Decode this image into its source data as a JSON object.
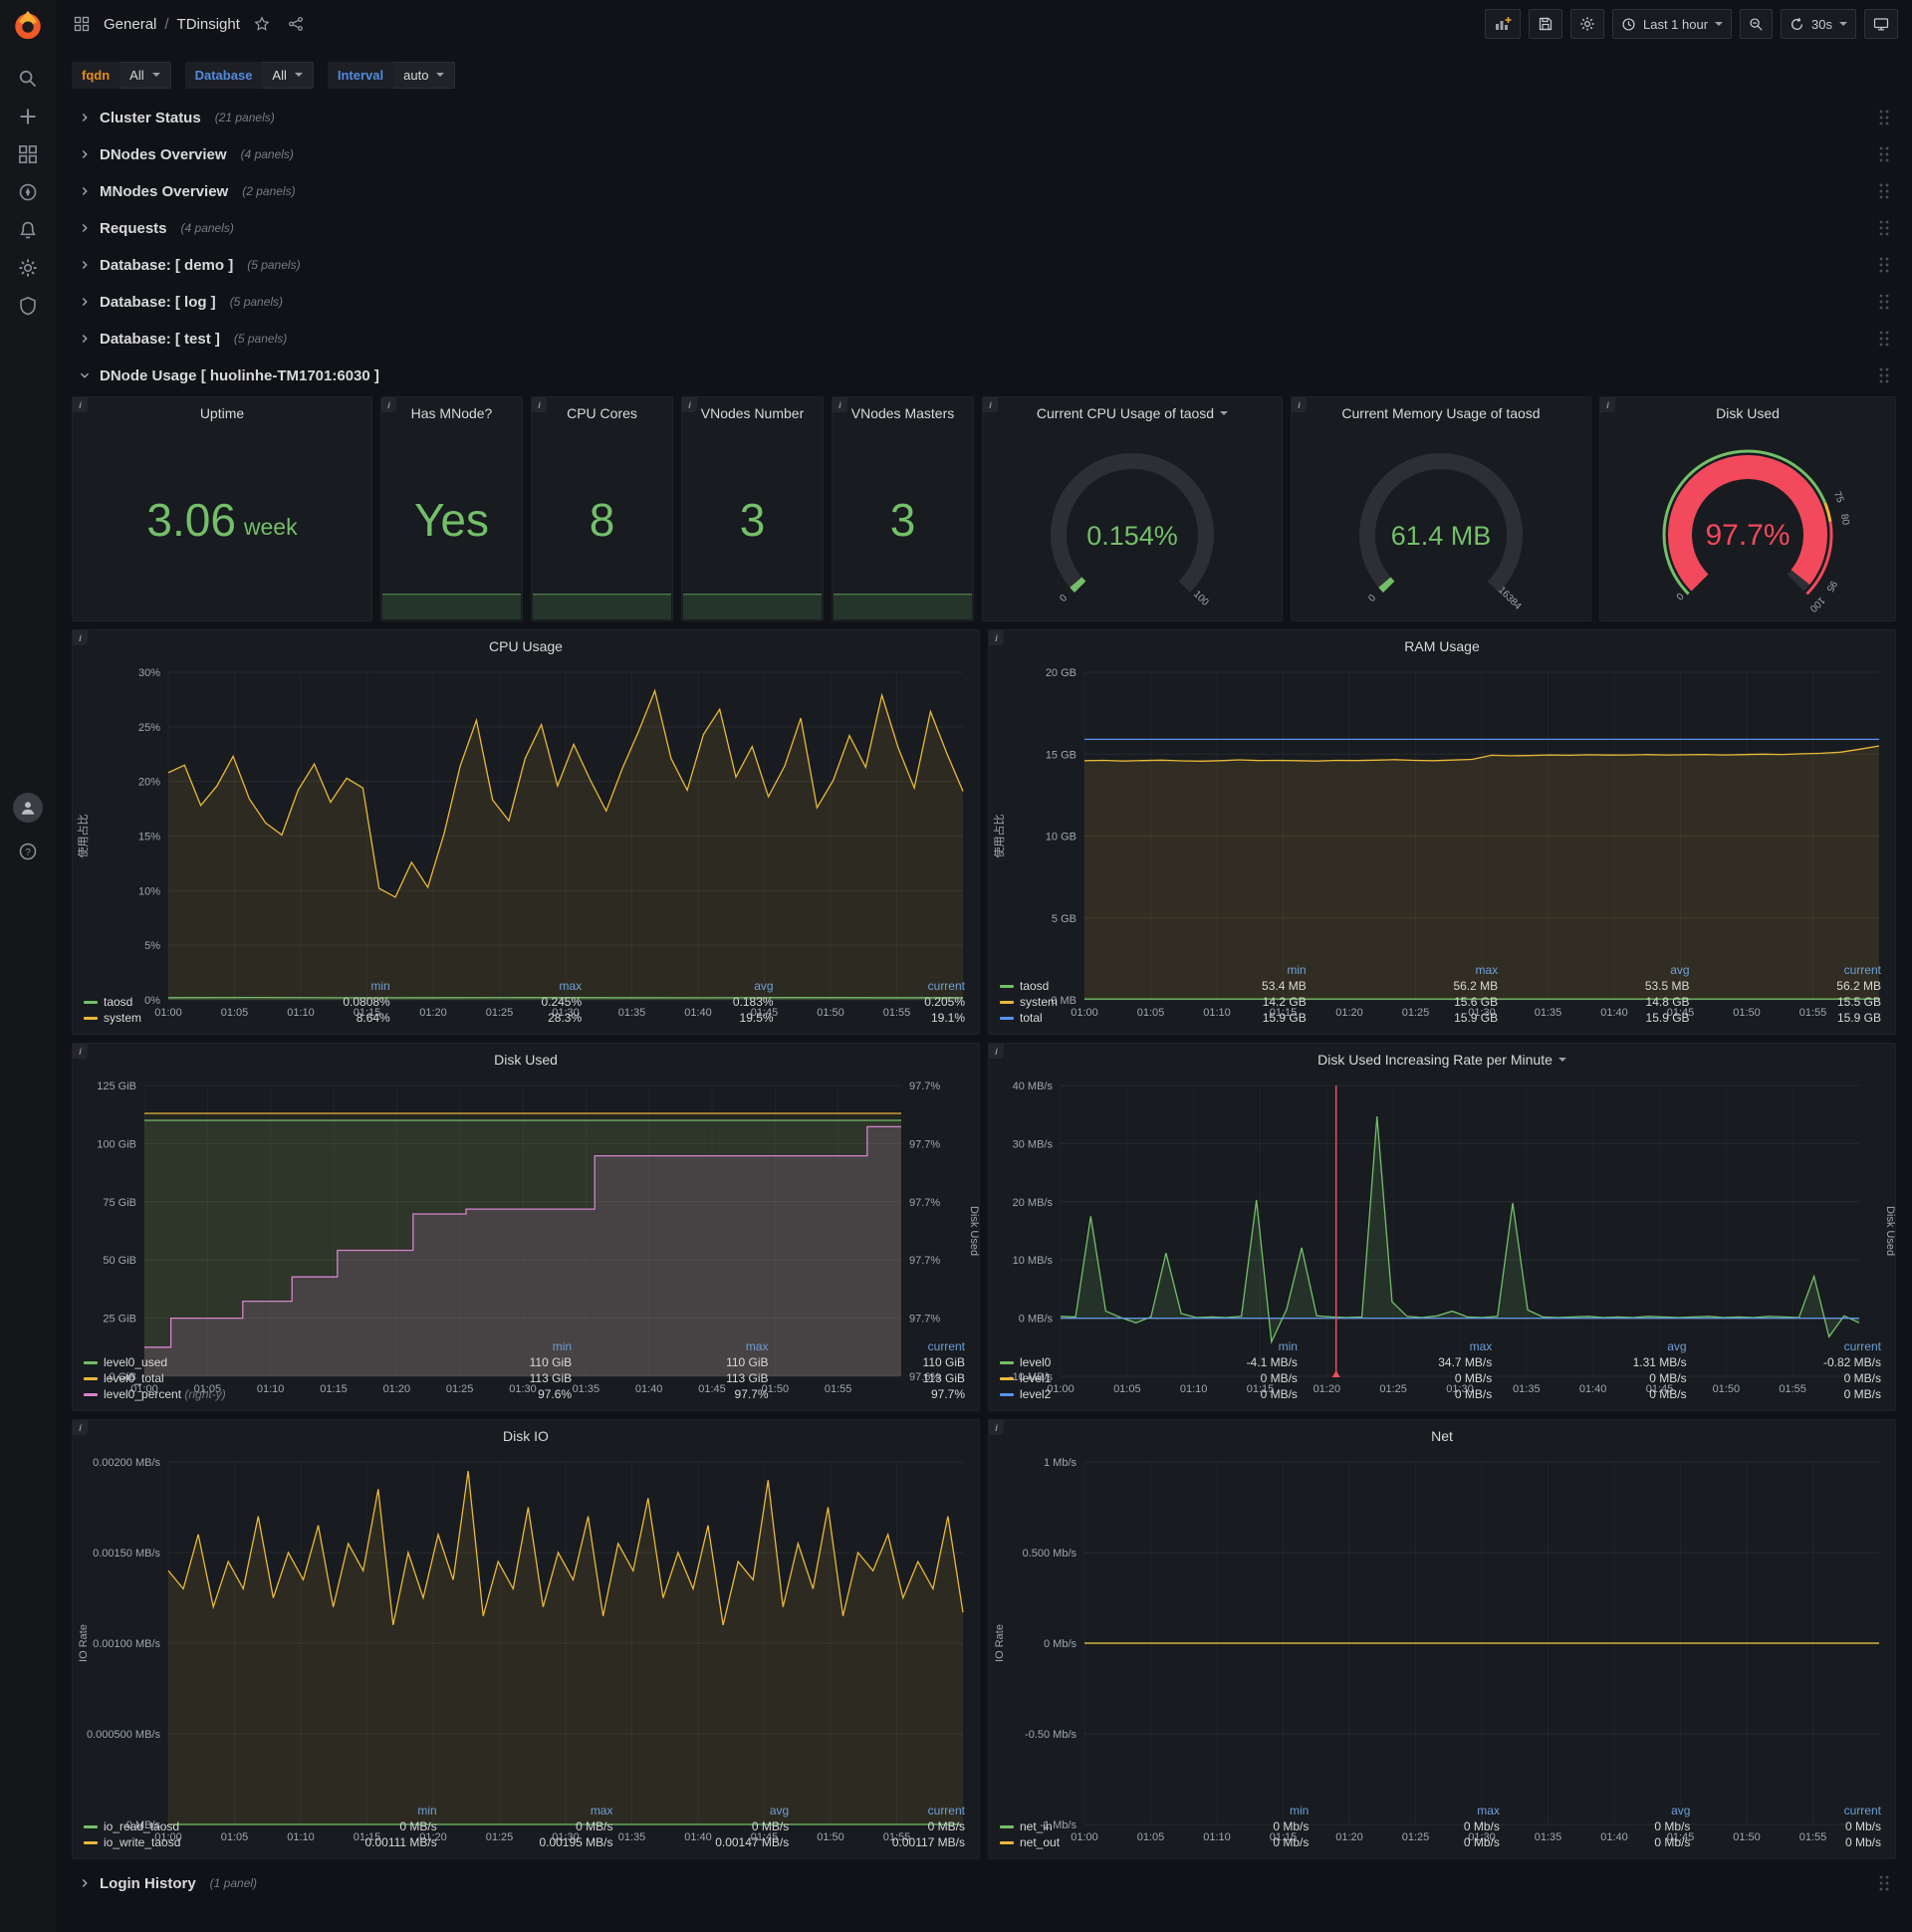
{
  "colors": {
    "green": "#73bf69",
    "yellow": "#eab839",
    "blue": "#5794f2",
    "pink": "#d683ce",
    "red": "#f2495c",
    "brand": "#f05a28",
    "legend_header": "#6e9fd8",
    "fqdn_label": "#e58c1d",
    "var_label": "#538ade"
  },
  "icons": {
    "rail": [
      "grafana-logo",
      "search",
      "plus",
      "dashboards",
      "explore",
      "alerting",
      "configuration",
      "server-admin",
      "avatar",
      "help"
    ],
    "navbar": [
      "dashboard-grid",
      "star",
      "share",
      "panel-add",
      "save",
      "settings",
      "clock",
      "zoom-out",
      "refresh",
      "caret-down",
      "tv"
    ]
  },
  "nav": {
    "breadcrumb": {
      "section": "General",
      "separator": "/",
      "title": "TDinsight"
    },
    "actions": {
      "time_range": "Last 1 hour",
      "refresh_interval": "30s"
    }
  },
  "filters": {
    "fqdn": {
      "label": "fqdn",
      "value": "All"
    },
    "database": {
      "label": "Database",
      "value": "All"
    },
    "interval": {
      "label": "Interval",
      "value": "auto"
    }
  },
  "collapsed_rows": [
    {
      "title": "Cluster Status",
      "count": "(21 panels)"
    },
    {
      "title": "DNodes Overview",
      "count": "(4 panels)"
    },
    {
      "title": "MNodes Overview",
      "count": "(2 panels)"
    },
    {
      "title": "Requests",
      "count": "(4 panels)"
    },
    {
      "title": "Database: [ demo ]",
      "count": "(5 panels)"
    },
    {
      "title": "Database: [ log ]",
      "count": "(5 panels)"
    },
    {
      "title": "Database: [ test ]",
      "count": "(5 panels)"
    }
  ],
  "expanded_row": {
    "title": "DNode Usage [ huolinhe-TM1701:6030 ]"
  },
  "bottom_row": {
    "title": "Login History",
    "count": "(1 panel)"
  },
  "stats": [
    {
      "title": "Uptime",
      "value": "3.06",
      "unit": "week"
    },
    {
      "title": "Has MNode?",
      "value": "Yes",
      "unit": ""
    },
    {
      "title": "CPU Cores",
      "value": "8",
      "unit": ""
    },
    {
      "title": "VNodes Number",
      "value": "3",
      "unit": ""
    },
    {
      "title": "VNodes Masters",
      "value": "3",
      "unit": ""
    }
  ],
  "gauges": [
    {
      "title": "Current CPU Usage of taosd",
      "has_caret": true,
      "value": "0.154%",
      "fraction": 0.00154,
      "color": "#73bf69",
      "min": "0",
      "max": "100",
      "thresholds": null
    },
    {
      "title": "Current Memory Usage of taosd",
      "has_caret": false,
      "value": "61.4 MB",
      "fraction": 0.0037,
      "color": "#73bf69",
      "min": "0",
      "max": "16384",
      "thresholds": null
    },
    {
      "title": "Disk Used",
      "has_caret": false,
      "value": "97.7%",
      "fraction": 0.977,
      "color": "#f2495c",
      "min": "0",
      "max": null,
      "thresholds": [
        {
          "frac": 0.75,
          "label": "75"
        },
        {
          "frac": 0.8,
          "label": "80"
        },
        {
          "frac": 0.95,
          "label": "95"
        },
        {
          "frac": 1,
          "label": "100"
        }
      ]
    }
  ],
  "chart_data": [
    {
      "type": "line",
      "title": "CPU Usage",
      "has_caret": false,
      "ylabel": "使用占比",
      "ylim": [
        0,
        30
      ],
      "y_ticks": [
        "30%",
        "25%",
        "20%",
        "15%",
        "10%",
        "5%",
        "0%"
      ],
      "x_ticks": [
        "01:00",
        "01:05",
        "01:10",
        "01:15",
        "01:20",
        "01:25",
        "01:30",
        "01:35",
        "01:40",
        "01:45",
        "01:50",
        "01:55"
      ],
      "legend": {
        "columns": [
          "min",
          "max",
          "avg",
          "current"
        ],
        "rows": [
          {
            "name": "taosd",
            "color": "#73bf69",
            "values": [
              "0.0808%",
              "0.245%",
              "0.183%",
              "0.205%"
            ]
          },
          {
            "name": "system",
            "color": "#eab839",
            "values": [
              "8.64%",
              "28.3%",
              "19.5%",
              "19.1%"
            ]
          }
        ]
      },
      "series": [
        {
          "name": "system",
          "color": "#eab839",
          "fill": 0.1,
          "values": [
            20.8,
            21.5,
            17.8,
            19.6,
            22.3,
            18.4,
            16.2,
            15.1,
            19.2,
            21.6,
            18.1,
            20.3,
            19.4,
            10.2,
            9.4,
            12.6,
            10.3,
            15.2,
            21.4,
            25.6,
            18.3,
            16.4,
            22.1,
            25.2,
            19.6,
            23.4,
            20.2,
            17.3,
            21.2,
            24.6,
            28.3,
            22.1,
            19.2,
            24.3,
            26.6,
            20.4,
            23.2,
            18.6,
            21.4,
            25.8,
            17.6,
            20.1,
            24.2,
            21.3,
            27.9,
            23.1,
            19.4,
            26.4,
            22.6,
            19.1
          ]
        },
        {
          "name": "taosd",
          "color": "#73bf69",
          "fill": 0.15,
          "values": [
            0.2,
            0.22,
            0.19,
            0.2,
            0.21,
            0.2,
            0.19,
            0.21,
            0.2,
            0.2
          ]
        }
      ]
    },
    {
      "type": "line",
      "title": "RAM Usage",
      "has_caret": false,
      "ylabel": "使用占比",
      "ylim": [
        0,
        20
      ],
      "y_ticks": [
        "20 GB",
        "15 GB",
        "10 GB",
        "5 GB",
        "0 MB"
      ],
      "x_ticks": [
        "01:00",
        "01:05",
        "01:10",
        "01:15",
        "01:20",
        "01:25",
        "01:30",
        "01:35",
        "01:40",
        "01:45",
        "01:50",
        "01:55"
      ],
      "legend": {
        "columns": [
          "min",
          "max",
          "avg",
          "current"
        ],
        "rows": [
          {
            "name": "taosd",
            "color": "#73bf69",
            "values": [
              "53.4 MB",
              "56.2 MB",
              "53.5 MB",
              "56.2 MB"
            ]
          },
          {
            "name": "system",
            "color": "#eab839",
            "values": [
              "14.2 GB",
              "15.6 GB",
              "14.8 GB",
              "15.5 GB"
            ]
          },
          {
            "name": "total",
            "color": "#5794f2",
            "values": [
              "15.9 GB",
              "15.9 GB",
              "15.9 GB",
              "15.9 GB"
            ]
          }
        ]
      },
      "series": [
        {
          "name": "system",
          "color": "#eab839",
          "fill": 0.12,
          "values": [
            14.6,
            14.62,
            14.58,
            14.61,
            14.63,
            14.59,
            14.57,
            14.6,
            14.65,
            14.61,
            14.62,
            14.6,
            14.58,
            14.62,
            14.61,
            14.63,
            14.66,
            14.62,
            14.6,
            14.64,
            14.68,
            14.93,
            14.9,
            14.92,
            14.95,
            14.93,
            14.96,
            14.94,
            14.95,
            14.97,
            14.95,
            14.96,
            14.98,
            14.95,
            14.97,
            15.0,
            14.98,
            15.02,
            15.05,
            15.12,
            15.3,
            15.5
          ]
        },
        {
          "name": "taosd",
          "color": "#73bf69",
          "fill": 0.2,
          "values": [
            0.055,
            0.055
          ]
        },
        {
          "name": "total",
          "color": "#5794f2",
          "fill": 0,
          "values": [
            15.9,
            15.9
          ]
        }
      ]
    },
    {
      "type": "line",
      "title": "Disk Used",
      "has_caret": false,
      "ylabel": null,
      "ylim": [
        0,
        125
      ],
      "right_ylim": [
        97.6,
        97.72
      ],
      "right_label": "Disk Used",
      "y_ticks": [
        "125 GiB",
        "100 GiB",
        "75 GiB",
        "50 GiB",
        "25 GiB",
        "0 GiB"
      ],
      "right_ticks": [
        "97.7%",
        "97.7%",
        "97.7%",
        "97.7%",
        "97.7%",
        "97.6%"
      ],
      "x_ticks": [
        "01:00",
        "01:05",
        "01:10",
        "01:15",
        "01:20",
        "01:25",
        "01:30",
        "01:35",
        "01:40",
        "01:45",
        "01:50",
        "01:55"
      ],
      "legend": {
        "columns": [
          "min",
          "max",
          "current"
        ],
        "rows": [
          {
            "name": "level0_used",
            "color": "#73bf69",
            "values": [
              "110 GiB",
              "110 GiB",
              "110 GiB"
            ]
          },
          {
            "name": "level0_total",
            "color": "#eab839",
            "values": [
              "113 GiB",
              "113 GiB",
              "113 GiB"
            ]
          },
          {
            "name": "level0_percent",
            "color": "#d683ce",
            "note": "(right-y)",
            "values": [
              "97.6%",
              "97.7%",
              "97.7%"
            ]
          }
        ]
      },
      "series": [
        {
          "name": "level0_total",
          "color": "#eab839",
          "fill": 0.06,
          "values": [
            113,
            113
          ]
        },
        {
          "name": "level0_used",
          "color": "#73bf69",
          "fill": 0.12,
          "values": [
            110,
            110
          ]
        },
        {
          "name": "level0_percent",
          "color": "#d683ce",
          "fill": 0.16,
          "axis": "right",
          "points": [
            [
              0,
              97.612
            ],
            [
              0.035,
              97.612
            ],
            [
              0.035,
              97.624
            ],
            [
              0.13,
              97.624
            ],
            [
              0.13,
              97.631
            ],
            [
              0.195,
              97.631
            ],
            [
              0.195,
              97.641
            ],
            [
              0.255,
              97.641
            ],
            [
              0.255,
              97.652
            ],
            [
              0.355,
              97.652
            ],
            [
              0.355,
              97.667
            ],
            [
              0.425,
              97.667
            ],
            [
              0.425,
              97.669
            ],
            [
              0.595,
              97.669
            ],
            [
              0.595,
              97.691
            ],
            [
              0.955,
              97.691
            ],
            [
              0.955,
              97.703
            ],
            [
              1,
              97.703
            ]
          ]
        }
      ]
    },
    {
      "type": "line",
      "title": "Disk Used Increasing Rate per Minute",
      "has_caret": true,
      "ylabel": null,
      "ylim": [
        -10,
        40
      ],
      "right_label": "Disk Used",
      "y_ticks": [
        "40 MB/s",
        "30 MB/s",
        "20 MB/s",
        "10 MB/s",
        "0 MB/s",
        "-10 MB/s"
      ],
      "x_ticks": [
        "01:00",
        "01:05",
        "01:10",
        "01:15",
        "01:20",
        "01:25",
        "01:30",
        "01:35",
        "01:40",
        "01:45",
        "01:50",
        "01:55"
      ],
      "annotation_x": 0.345,
      "legend": {
        "columns": [
          "min",
          "max",
          "avg",
          "current"
        ],
        "rows": [
          {
            "name": "level0",
            "color": "#73bf69",
            "values": [
              "-4.1 MB/s",
              "34.7 MB/s",
              "1.31 MB/s",
              "-0.82 MB/s"
            ]
          },
          {
            "name": "level1",
            "color": "#eab839",
            "values": [
              "0 MB/s",
              "0 MB/s",
              "0 MB/s",
              "0 MB/s"
            ]
          },
          {
            "name": "level2",
            "color": "#5794f2",
            "values": [
              "0 MB/s",
              "0 MB/s",
              "0 MB/s",
              "0 MB/s"
            ]
          }
        ]
      },
      "series": [
        {
          "name": "level0",
          "color": "#73bf69",
          "fill": 0.15,
          "fill_to_zero": true,
          "values": [
            0.3,
            0.2,
            17.5,
            1.2,
            0.1,
            -0.8,
            0.2,
            11.2,
            0.8,
            0.1,
            0.2,
            0.1,
            0.3,
            20.3,
            -4.1,
            1.5,
            12.1,
            0.4,
            0.2,
            0.1,
            0.2,
            34.7,
            2.8,
            0.3,
            0.1,
            0.4,
            1.2,
            0.2,
            0.1,
            0.3,
            19.8,
            1.4,
            0.2,
            0.1,
            0.2,
            0.3,
            0.1,
            0.2,
            0.1,
            0.3,
            0.2,
            0.1,
            0.2,
            0.3,
            0.1,
            0.2,
            0.1,
            0.3,
            0.2,
            0.1,
            7.2,
            -3.2,
            0.4,
            -0.8
          ]
        },
        {
          "name": "level1",
          "color": "#eab839",
          "fill": 0,
          "values": [
            0,
            0
          ]
        },
        {
          "name": "level2",
          "color": "#5794f2",
          "fill": 0,
          "values": [
            0,
            0
          ]
        }
      ]
    },
    {
      "type": "line",
      "title": "Disk IO",
      "has_caret": false,
      "ylabel": "IO Rate",
      "ylim": [
        0,
        0.002
      ],
      "y_ticks": [
        "0.00200 MB/s",
        "0.00150 MB/s",
        "0.00100 MB/s",
        "0.000500 MB/s",
        "0 MB/s"
      ],
      "x_ticks": [
        "01:00",
        "01:05",
        "01:10",
        "01:15",
        "01:20",
        "01:25",
        "01:30",
        "01:35",
        "01:40",
        "01:45",
        "01:50",
        "01:55"
      ],
      "legend": {
        "columns": [
          "min",
          "max",
          "avg",
          "current"
        ],
        "rows": [
          {
            "name": "io_read_taosd",
            "color": "#73bf69",
            "values": [
              "0 MB/s",
              "0 MB/s",
              "0 MB/s",
              "0 MB/s"
            ]
          },
          {
            "name": "io_write_taosd",
            "color": "#eab839",
            "values": [
              "0.00111 MB/s",
              "0.00195 MB/s",
              "0.00147 MB/s",
              "0.00117 MB/s"
            ]
          }
        ]
      },
      "series": [
        {
          "name": "io_write_taosd",
          "color": "#eab839",
          "fill": 0.1,
          "values": [
            0.0014,
            0.0013,
            0.0016,
            0.0012,
            0.00145,
            0.0013,
            0.0017,
            0.00125,
            0.0015,
            0.00135,
            0.00165,
            0.0012,
            0.00155,
            0.0014,
            0.00185,
            0.0011,
            0.0015,
            0.00125,
            0.0016,
            0.00135,
            0.00195,
            0.00115,
            0.00145,
            0.0013,
            0.00175,
            0.0012,
            0.0015,
            0.00135,
            0.0017,
            0.00115,
            0.00155,
            0.0014,
            0.0018,
            0.00125,
            0.0015,
            0.0013,
            0.00165,
            0.0011,
            0.00145,
            0.00135,
            0.0019,
            0.0012,
            0.00155,
            0.0013,
            0.00175,
            0.00115,
            0.0015,
            0.0014,
            0.0016,
            0.00125,
            0.00145,
            0.0013,
            0.0017,
            0.00117
          ]
        },
        {
          "name": "io_read_taosd",
          "color": "#73bf69",
          "fill": 0,
          "values": [
            0,
            0
          ]
        }
      ]
    },
    {
      "type": "line",
      "title": "Net",
      "has_caret": false,
      "ylabel": "IO Rate",
      "ylim": [
        -1,
        1
      ],
      "y_ticks": [
        "1 Mb/s",
        "0.500 Mb/s",
        "0 Mb/s",
        "-0.50 Mb/s",
        "-1 Mb/s"
      ],
      "x_ticks": [
        "01:00",
        "01:05",
        "01:10",
        "01:15",
        "01:20",
        "01:25",
        "01:30",
        "01:35",
        "01:40",
        "01:45",
        "01:50",
        "01:55"
      ],
      "legend": {
        "columns": [
          "min",
          "max",
          "avg",
          "current"
        ],
        "rows": [
          {
            "name": "net_in",
            "color": "#73bf69",
            "values": [
              "0 Mb/s",
              "0 Mb/s",
              "0 Mb/s",
              "0 Mb/s"
            ]
          },
          {
            "name": "net_out",
            "color": "#eab839",
            "values": [
              "0 Mb/s",
              "0 Mb/s",
              "0 Mb/s",
              "0 Mb/s"
            ]
          }
        ]
      },
      "series": [
        {
          "name": "net_in",
          "color": "#73bf69",
          "fill": 0,
          "values": [
            0,
            0
          ]
        },
        {
          "name": "net_out",
          "color": "#eab839",
          "fill": 0,
          "values": [
            0,
            0
          ]
        }
      ]
    }
  ]
}
